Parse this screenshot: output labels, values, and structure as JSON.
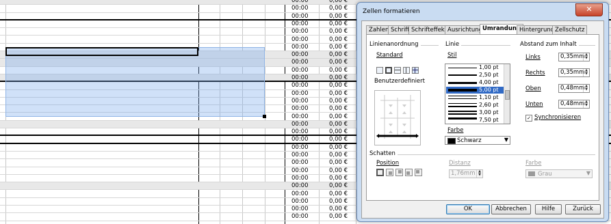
{
  "sheet": {
    "time_value": "00:00",
    "money_value": "0,00 €",
    "row_count": 29,
    "gray_rows": [
      0,
      7,
      8,
      10,
      16,
      24
    ],
    "thick_after_rows": [
      2,
      10,
      17,
      18
    ]
  },
  "dialog": {
    "title": "Zellen formatieren",
    "close_glyph": "✕",
    "tabs": [
      "Zahlen",
      "Schrift",
      "Schrifteffekt",
      "Ausrichtung",
      "Umrandung",
      "Hintergrund",
      "Zellschutz"
    ],
    "active_tab": "Umrandung",
    "linienanordnung": {
      "title": "Linienanordnung",
      "standard_label": "Standard",
      "benutzerdefiniert_label": "Benutzerdefiniert"
    },
    "linie": {
      "title": "Linie",
      "stil_label": "Stil",
      "styles": [
        "1,00 pt",
        "2,50 pt",
        "4,00 pt",
        "5,00 pt",
        "1,10 pt",
        "2,60 pt",
        "3,00 pt",
        "7,50 pt"
      ],
      "selected_style": "5,00 pt",
      "farbe_label": "Farbe",
      "farbe_value": "Schwarz",
      "farbe_color": "#000000"
    },
    "abstand": {
      "title": "Abstand zum Inhalt",
      "links_label": "Links",
      "links_value": "0,35mm",
      "rechts_label": "Rechts",
      "rechts_value": "0,35mm",
      "oben_label": "Oben",
      "oben_value": "0,48mm",
      "unten_label": "Unten",
      "unten_value": "0,48mm",
      "sync_label": "Synchronisieren",
      "sync_checked": true
    },
    "schatten": {
      "title": "Schatten",
      "position_label": "Position",
      "distanz_label": "Distanz",
      "distanz_value": "1,76mm",
      "farbe_label": "Farbe",
      "farbe_value": "Grau",
      "farbe_color": "#808080"
    },
    "buttons": {
      "ok": "OK",
      "abbrechen": "Abbrechen",
      "hilfe": "Hilfe",
      "zurueck": "Zurück"
    }
  }
}
